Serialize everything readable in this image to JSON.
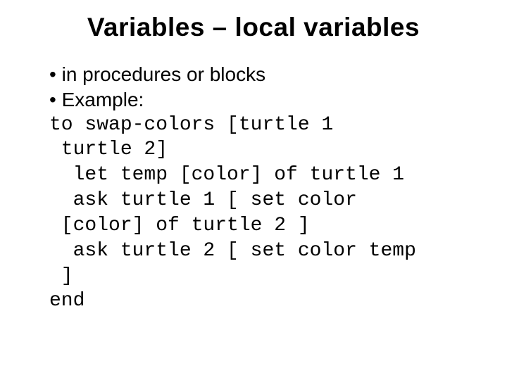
{
  "title": "Variables – local variables",
  "bullets": [
    "in procedures or blocks",
    "Example:"
  ],
  "code": {
    "line1": "to swap-colors [turtle 1",
    "line2": " turtle 2]",
    "line3": "  let temp [color] of turtle 1",
    "line4": "  ask turtle 1 [ set color",
    "line5": " [color] of turtle 2 ]",
    "line6": "  ask turtle 2 [ set color temp",
    "line7": " ]",
    "line8": "end"
  }
}
